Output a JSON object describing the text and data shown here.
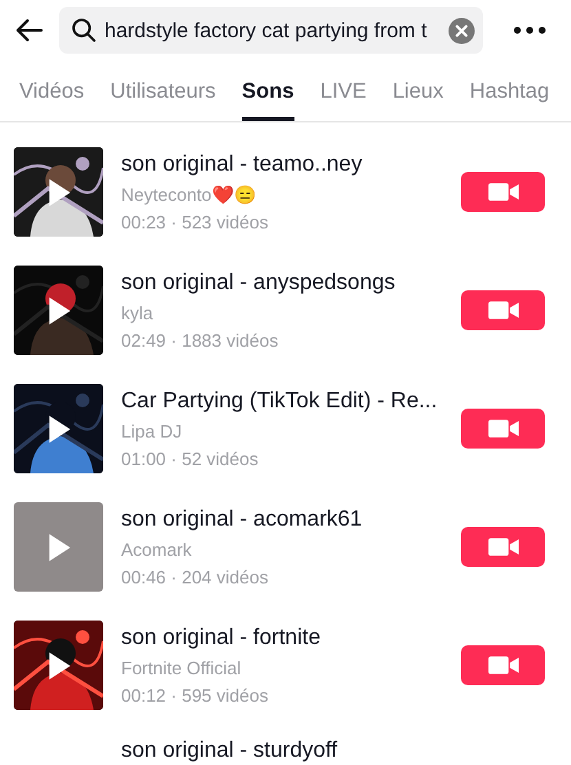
{
  "search": {
    "value": "hardstyle factory cat partying from t"
  },
  "tabs": [
    {
      "label": "Vidéos",
      "selected": false
    },
    {
      "label": "Utilisateurs",
      "selected": false
    },
    {
      "label": "Sons",
      "selected": true
    },
    {
      "label": "LIVE",
      "selected": false
    },
    {
      "label": "Lieux",
      "selected": false
    },
    {
      "label": "Hashtag",
      "selected": false
    }
  ],
  "sounds": [
    {
      "kind": "full",
      "title": "son original - teamo..ney",
      "artist": "Neyteconto❤️😑",
      "meta": "00:23 · 523 vidéos"
    },
    {
      "kind": "full",
      "title": "son original - anyspedsongs",
      "artist": "kyla",
      "meta": "02:49 · 1883 vidéos"
    },
    {
      "kind": "full",
      "title": "Car Partying (TikTok Edit) - Re...",
      "artist": "Lipa DJ",
      "meta": "01:00 · 52 vidéos"
    },
    {
      "kind": "full",
      "thumbnail": {
        "kind": "blank"
      },
      "title": "son original - acomark61",
      "artist": "Acomark",
      "meta": "00:46 · 204 vidéos"
    },
    {
      "kind": "full",
      "title": "son original - fortnite",
      "artist": "Fortnite Official",
      "meta": "00:12 · 595 vidéos"
    },
    {
      "kind": "partial",
      "title": "son original - sturdyoff"
    }
  ]
}
